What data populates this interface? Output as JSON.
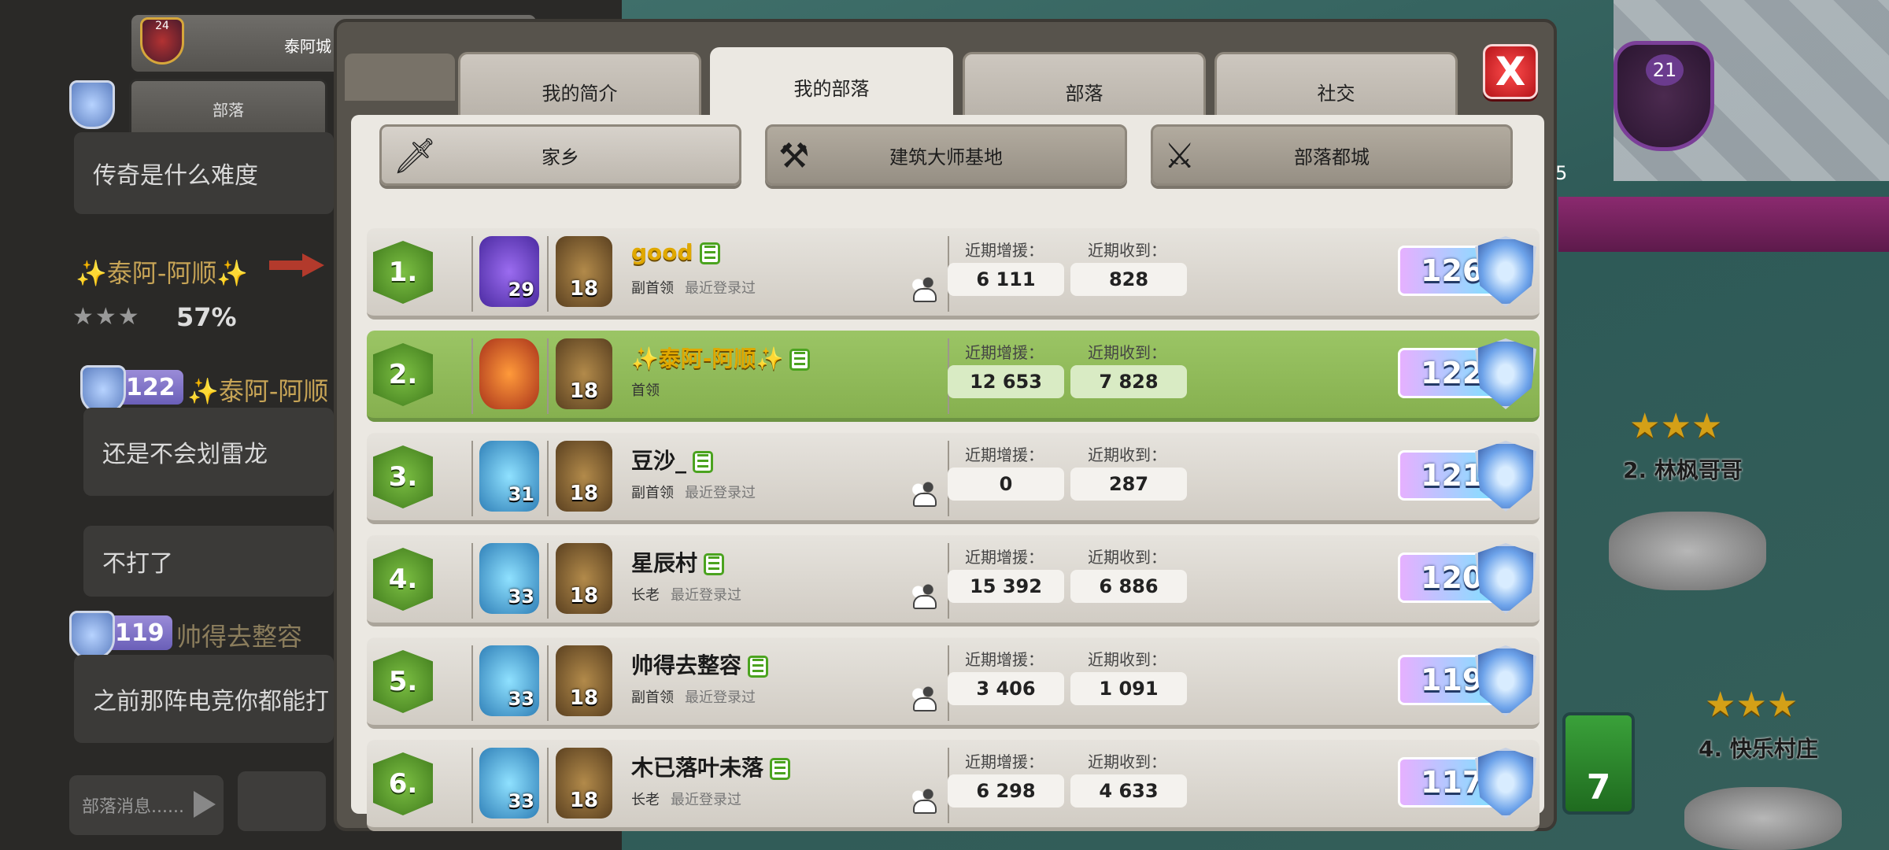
{
  "background": {
    "home_label": "泰阿城",
    "home_level": "24",
    "clan_tab": "部落",
    "chat": [
      {
        "text": "传奇是什么难度"
      },
      {
        "text": "还是不会划雷龙"
      },
      {
        "text": "不打了"
      },
      {
        "text": "之前那阵电竞你都能打"
      }
    ],
    "attack_player": "✨泰阿-阿顺✨",
    "attack_pct": "57%",
    "pill_122": "122",
    "pill_122_name": "✨泰阿-阿顺",
    "pill_119": "119",
    "pill_119_name": "帅得去整容",
    "input_placeholder": "部落消息......",
    "clan_level": "21",
    "sword_count": "5",
    "side_card_value": "7",
    "map_labels": [
      "2. 林枫哥哥",
      "4. 快乐村庄"
    ]
  },
  "tabs": [
    {
      "label": "我的简介",
      "active": false
    },
    {
      "label": "我的部落",
      "active": true
    },
    {
      "label": "部落",
      "active": false
    },
    {
      "label": "社交",
      "active": false
    }
  ],
  "close_label": "X",
  "sub_tabs": [
    {
      "label": "家乡",
      "icon": "sword-icon"
    },
    {
      "label": "建筑大师基地",
      "icon": "crossed-axes-icon"
    },
    {
      "label": "部落都城",
      "icon": "crossed-swords-icon"
    }
  ],
  "labels": {
    "donated": "近期增援：",
    "received": "近期收到："
  },
  "members": [
    {
      "rank": "1.",
      "xp": "29",
      "th": "18",
      "name": "good",
      "role": "副首领",
      "last": "最近登录过",
      "donated": "6 111",
      "received": "828",
      "trophies": "126",
      "me": false,
      "gold": true,
      "xp_style": "purple"
    },
    {
      "rank": "2.",
      "xp": "",
      "th": "18",
      "name": "✨泰阿-阿顺✨",
      "role": "首领",
      "last": "",
      "donated": "12 653",
      "received": "7 828",
      "trophies": "122",
      "me": true,
      "gold": true,
      "xp_style": "orange"
    },
    {
      "rank": "3.",
      "xp": "31",
      "th": "18",
      "name": "豆沙_",
      "role": "副首领",
      "last": "最近登录过",
      "donated": "0",
      "received": "287",
      "trophies": "121",
      "me": false,
      "gold": false,
      "xp_style": "teal"
    },
    {
      "rank": "4.",
      "xp": "33",
      "th": "18",
      "name": "星辰村",
      "role": "长老",
      "last": "最近登录过",
      "donated": "15 392",
      "received": "6 886",
      "trophies": "120",
      "me": false,
      "gold": false,
      "xp_style": "teal"
    },
    {
      "rank": "5.",
      "xp": "33",
      "th": "18",
      "name": "帅得去整容",
      "role": "副首领",
      "last": "最近登录过",
      "donated": "3 406",
      "received": "1 091",
      "trophies": "119",
      "me": false,
      "gold": false,
      "xp_style": "teal"
    },
    {
      "rank": "6.",
      "xp": "33",
      "th": "18",
      "name": "木已落叶未落",
      "role": "长老",
      "last": "最近登录过",
      "donated": "6 298",
      "received": "4 633",
      "trophies": "117",
      "me": false,
      "gold": false,
      "xp_style": "teal"
    }
  ]
}
